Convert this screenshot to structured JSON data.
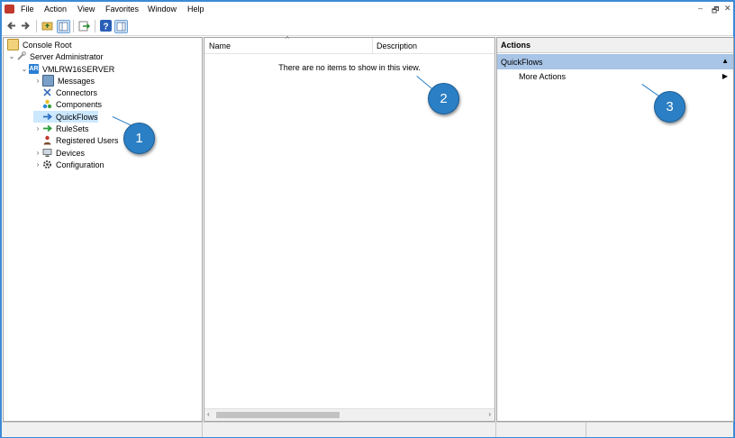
{
  "menu": [
    "File",
    "Action",
    "View",
    "Favorites",
    "Window",
    "Help"
  ],
  "window_controls": [
    "–",
    "🗗",
    "✕"
  ],
  "tree": {
    "root": "Console Root",
    "server_admin": "Server Administrator",
    "server": "VMLRW16SERVER",
    "server_badge": "AR",
    "items": [
      "Messages",
      "Connectors",
      "Components",
      "QuickFlows",
      "RuleSets",
      "Registered Users",
      "Devices",
      "Configuration"
    ]
  },
  "list": {
    "col_name": "Name",
    "col_description": "Description",
    "empty_text": "There are no items to show in this view."
  },
  "actions": {
    "header": "Actions",
    "section": "QuickFlows",
    "more_actions": "More Actions"
  },
  "callouts": [
    "1",
    "2",
    "3"
  ],
  "colors": {
    "accent": "#2b7fc4",
    "selection": "#cce8ff",
    "section": "#a8c4e6"
  }
}
